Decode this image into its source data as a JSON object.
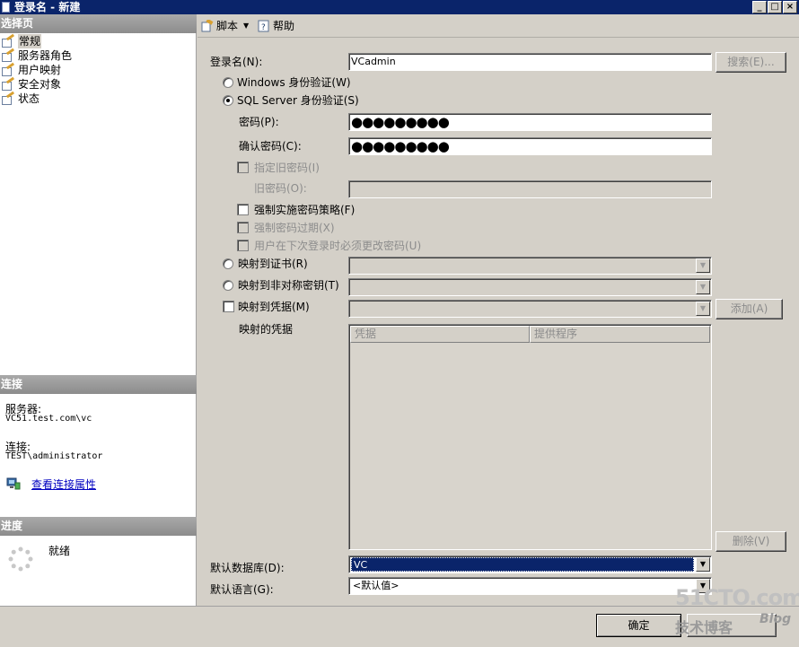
{
  "window": {
    "title": "登录名 - 新建",
    "controls": {
      "minimize": "_",
      "maximize": "□",
      "close": "×"
    }
  },
  "left_pane": {
    "select_page_header": "选择页",
    "pages": [
      {
        "label": "常规",
        "icon": "page-icon",
        "selected": true
      },
      {
        "label": "服务器角色",
        "icon": "page-icon",
        "selected": false
      },
      {
        "label": "用户映射",
        "icon": "page-icon",
        "selected": false
      },
      {
        "label": "安全对象",
        "icon": "page-icon",
        "selected": false
      },
      {
        "label": "状态",
        "icon": "page-icon",
        "selected": false
      }
    ],
    "connection_header": "连接",
    "server_label": "服务器:",
    "server_value": "VC51.test.com\\vc",
    "connection_label": "连接:",
    "connection_value": "TEST\\administrator",
    "view_connection_properties": "查看连接属性",
    "progress_header": "进度",
    "progress_status": "就绪"
  },
  "toolbar": {
    "script_label": "脚本",
    "help_label": "帮助"
  },
  "form": {
    "login_name_label": "登录名(N):",
    "login_name_value": "VCadmin",
    "search_button": "搜索(E)...",
    "windows_auth_label": "Windows 身份验证(W)",
    "sql_auth_label": "SQL Server 身份验证(S)",
    "password_label": "密码(P):",
    "password_value": "●●●●●●●●●",
    "confirm_password_label": "确认密码(C):",
    "confirm_password_value": "●●●●●●●●●",
    "specify_old_password_label": "指定旧密码(I)",
    "old_password_label": "旧密码(O):",
    "enforce_policy_label": "强制实施密码策略(F)",
    "enforce_expiration_label": "强制密码过期(X)",
    "must_change_label": "用户在下次登录时必须更改密码(U)",
    "map_certificate_label": "映射到证书(R)",
    "map_asymmetric_key_label": "映射到非对称密钥(T)",
    "map_credential_label": "映射到凭据(M)",
    "add_button": "添加(A)",
    "mapped_credentials_label": "映射的凭据",
    "grid_columns": [
      "凭据",
      "提供程序"
    ],
    "remove_button": "删除(V)",
    "default_database_label": "默认数据库(D):",
    "default_database_value": "VC",
    "default_language_label": "默认语言(G):",
    "default_language_value": "<默认值>"
  },
  "footer": {
    "ok_button": "确定"
  },
  "watermark": {
    "site": "51CTO.com",
    "caption": "技术博客",
    "blog": "Blog"
  },
  "colors": {
    "title_bar": "#0a246a",
    "selection_highlight": "#0a246a",
    "section_header": "#8c8c8c",
    "dialog_face": "#d4d0c8"
  }
}
